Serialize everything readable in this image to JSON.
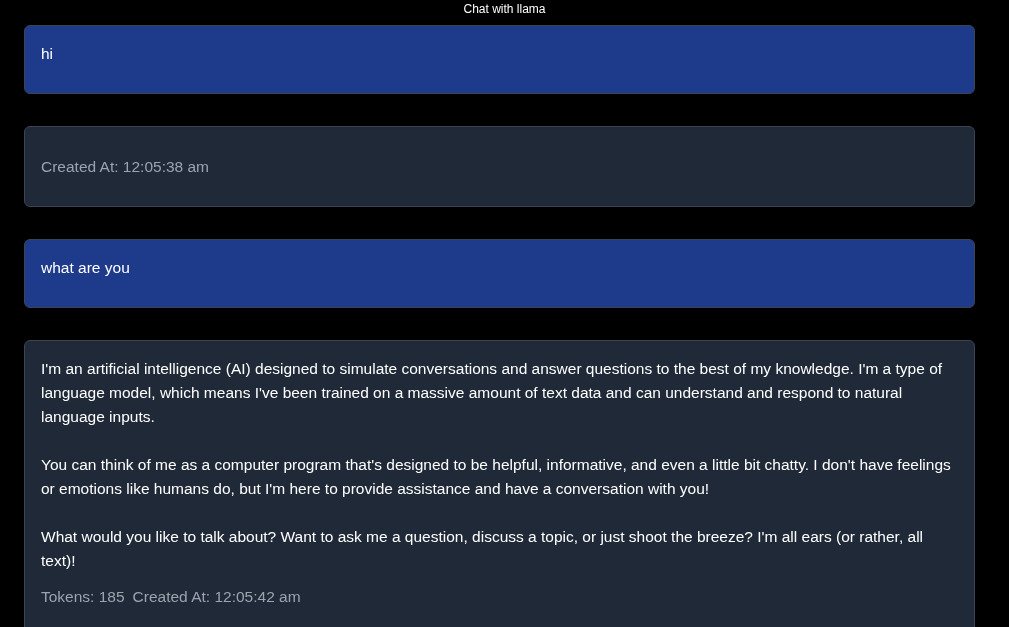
{
  "title": "Chat with llama",
  "messages": [
    {
      "kind": "user",
      "paragraphs": [
        "hi"
      ]
    },
    {
      "kind": "reply",
      "created_at": "Created At: 12:05:38 am"
    },
    {
      "kind": "user",
      "paragraphs": [
        "what are you"
      ]
    },
    {
      "kind": "reply",
      "paragraphs": [
        "I'm an artificial intelligence (AI) designed to simulate conversations and answer questions to the best of my knowledge. I'm a type of language model, which means I've been trained on a massive amount of text data and can understand and respond to natural language inputs.",
        "You can think of me as a computer program that's designed to be helpful, informative, and even a little bit chatty. I don't have feelings or emotions like humans do, but I'm here to provide assistance and have a conversation with you!",
        "What would you like to talk about? Want to ask me a question, discuss a topic, or just shoot the breeze? I'm all ears (or rather, all text)!"
      ],
      "tokens": "Tokens: 185",
      "created_at": "Created At: 12:05:42 am"
    }
  ]
}
